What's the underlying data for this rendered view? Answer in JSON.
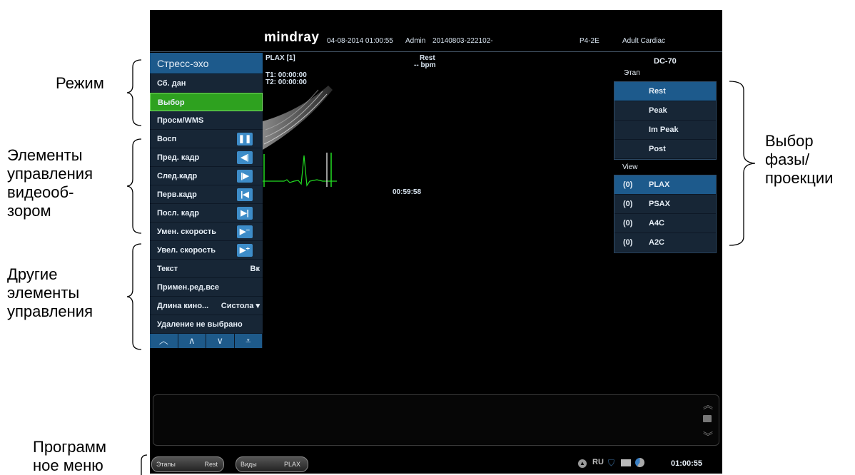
{
  "annotations": {
    "mode": "Режим",
    "video_controls": [
      "Элементы",
      "управления",
      "видеооб-",
      "зором"
    ],
    "other_controls": [
      "Другие",
      "элементы",
      "управления"
    ],
    "phase_select": [
      "Выбор",
      "фазы/",
      "проекции"
    ],
    "soft_menu": [
      "Программ",
      "ное меню"
    ]
  },
  "header": {
    "brand": "mindray",
    "datetime": "04-08-2014 01:00:55",
    "user": "Admin",
    "exam_id": "20140803-222102-",
    "probe": "P4-2E",
    "preset": "Adult Cardiac"
  },
  "left_menu": {
    "title": "Стресс-эхо",
    "mode_items": [
      "Сб. дан",
      "Выбор",
      "Просм/WMS"
    ],
    "playback": [
      {
        "label": "Восп",
        "icon": "pause-icon"
      },
      {
        "label": "Пред. кадр",
        "icon": "prev-frame-icon"
      },
      {
        "label": "След.кадр",
        "icon": "next-frame-icon"
      },
      {
        "label": "Перв.кадр",
        "icon": "first-frame-icon"
      },
      {
        "label": "Посл. кадр",
        "icon": "last-frame-icon"
      },
      {
        "label": "Умен. скорость",
        "icon": "slower-icon"
      },
      {
        "label": "Увел. скорость",
        "icon": "faster-icon"
      }
    ],
    "other": {
      "text_label": "Текст",
      "text_value": "Вк",
      "apply_all": "Примен.ред.все",
      "cine_label": "Длина кино...",
      "cine_value": "Систола",
      "delete_label": "Удаление не выбрано"
    }
  },
  "image": {
    "view": "PLAX [1]",
    "stage": "Rest",
    "bpm": "-- bpm",
    "t1": "T1: 00:00:00",
    "t2": "T2: 00:00:00",
    "timer": "00:59:58"
  },
  "right_panel": {
    "system": "DC-70",
    "stage_label": "Этап",
    "stages": [
      "Rest",
      "Peak",
      "Im Peak",
      "Post"
    ],
    "view_label": "View",
    "views": [
      {
        "count": "(0)",
        "name": "PLAX"
      },
      {
        "count": "(0)",
        "name": "PSAX"
      },
      {
        "count": "(0)",
        "name": "A4C"
      },
      {
        "count": "(0)",
        "name": "A2C"
      }
    ]
  },
  "status_bar": {
    "btn1_label": "Этапы",
    "btn1_value": "Rest",
    "btn2_label": "Виды",
    "btn2_value": "PLAX",
    "language": "RU",
    "time": "01:00:55"
  },
  "colors": {
    "selected_green": "#2ea11f",
    "accent_blue": "#1d5a8c",
    "ecg_green": "#22dd22"
  }
}
